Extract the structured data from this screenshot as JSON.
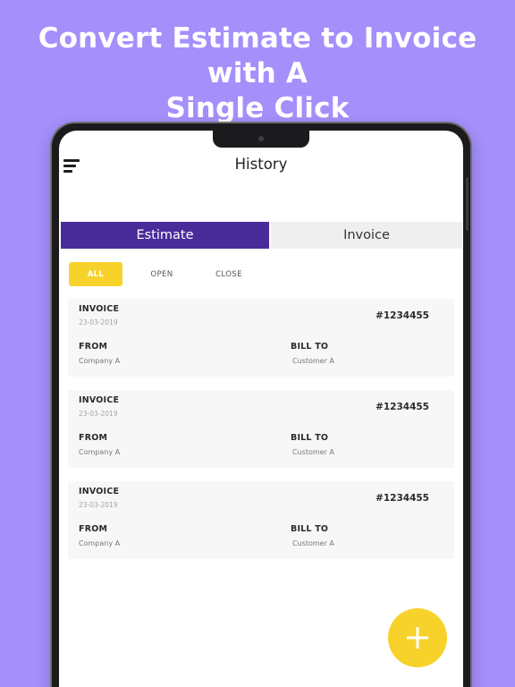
{
  "promo": {
    "title_line1": "Convert Estimate to Invoice with A",
    "title_line2": "Single Click"
  },
  "header": {
    "title": "History",
    "menu_icon": "hamburger-menu-icon"
  },
  "tabs": [
    {
      "label": "Estimate",
      "active": true
    },
    {
      "label": "Invoice",
      "active": false
    }
  ],
  "filters": [
    {
      "label": "ALL",
      "active": true
    },
    {
      "label": "OPEN",
      "active": false
    },
    {
      "label": "CLOSE",
      "active": false
    }
  ],
  "cards": [
    {
      "type": "INVOICE",
      "date": "23-03-2019",
      "number": "#1234455",
      "from_label": "FROM",
      "from_value": "Company A",
      "bill_label": "BILL TO",
      "bill_value": "Customer A"
    },
    {
      "type": "INVOICE",
      "date": "23-03-2019",
      "number": "#1234455",
      "from_label": "FROM",
      "from_value": "Company A",
      "bill_label": "BILL TO",
      "bill_value": "Customer A"
    },
    {
      "type": "INVOICE",
      "date": "23-03-2019",
      "number": "#1234455",
      "from_label": "FROM",
      "from_value": "Company A",
      "bill_label": "BILL TO",
      "bill_value": "Customer A"
    }
  ],
  "fab": {
    "icon": "plus-icon"
  },
  "colors": {
    "background": "#a58ffb",
    "active_tab": "#4a2b9a",
    "accent_yellow": "#f7d22a"
  }
}
